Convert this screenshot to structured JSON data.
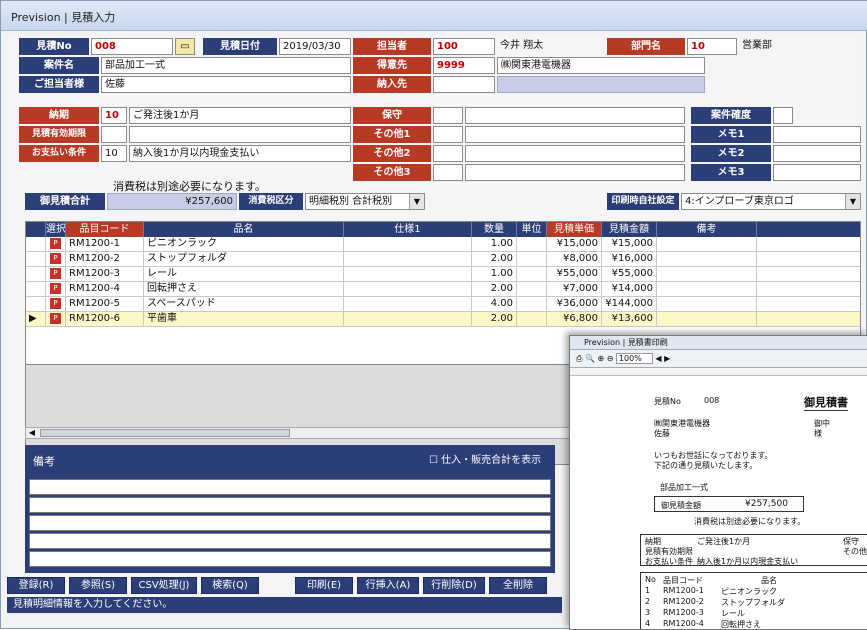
{
  "window": {
    "title": "Prevision | 見積入力"
  },
  "header": {
    "mitsumori_no_label": "見積No",
    "mitsumori_no": "008",
    "mitsumori_date_label": "見積日付",
    "mitsumori_date": "2019/03/30",
    "tanto_label": "担当者",
    "tanto_code": "100",
    "tanto_name": "今井 翔太",
    "bumon_label": "部門名",
    "bumon_code": "10",
    "bumon_name": "営業部",
    "kenmei_label": "案件名",
    "kenmei": "部品加工一式",
    "tokuisaki_label": "得意先",
    "tokuisaki_code": "9999",
    "tokuisaki_name": "㈱関東港電機器",
    "gotanto_label": "ご担当者様",
    "gotanto": "佐藤",
    "nounyu_label": "納入先",
    "nounyu": ""
  },
  "terms": {
    "nouki_label": "納期",
    "nouki_code": "10",
    "nouki": "ご発注後1か月",
    "yuko_label": "見積有効期限",
    "yuko": "",
    "shiharai_label": "お支払い条件",
    "shiharai_code": "10",
    "shiharai": "納入後1か月以内現金支払い",
    "hoshu_label": "保守",
    "hoshu": "",
    "other1_label": "その他1",
    "other1": "",
    "other2_label": "その他2",
    "other2": "",
    "other3_label": "その他3",
    "other3": "",
    "kakudo_label": "案件確度",
    "kakudo": "",
    "memo1_label": "メモ1",
    "memo1": "",
    "memo2_label": "メモ2",
    "memo2": "",
    "memo3_label": "メモ3",
    "memo3": ""
  },
  "summary": {
    "tax_note": "消費税は別途必要になります。",
    "total_label": "御見積合計",
    "total": "¥257,600",
    "tax_kubun_label": "消費税区分",
    "tax_kubun": "明細税別 合計税別",
    "print_label": "印刷時自社設定",
    "print_setting": "4:インプローブ東京ロゴ"
  },
  "grid": {
    "headers": [
      "選択",
      "品目コード",
      "品名",
      "仕様1",
      "数量",
      "単位",
      "見積単価",
      "見積金額",
      "備考"
    ],
    "rows": [
      {
        "code": "RM1200-1",
        "name": "ピニオンラック",
        "spec": "",
        "qty": "1.00",
        "unit": "",
        "price": "¥15,000",
        "amount": "¥15,000",
        "note": ""
      },
      {
        "code": "RM1200-2",
        "name": "ストップフォルダ",
        "spec": "",
        "qty": "2.00",
        "unit": "",
        "price": "¥8,000",
        "amount": "¥16,000",
        "note": ""
      },
      {
        "code": "RM1200-3",
        "name": "レール",
        "spec": "",
        "qty": "1.00",
        "unit": "",
        "price": "¥55,000",
        "amount": "¥55,000",
        "note": ""
      },
      {
        "code": "RM1200-4",
        "name": "回転押さえ",
        "spec": "",
        "qty": "2.00",
        "unit": "",
        "price": "¥7,000",
        "amount": "¥14,000",
        "note": ""
      },
      {
        "code": "RM1200-5",
        "name": "スペースパッド",
        "spec": "",
        "qty": "4.00",
        "unit": "",
        "price": "¥36,000",
        "amount": "¥144,000",
        "note": ""
      },
      {
        "code": "RM1200-6",
        "name": "平歯車",
        "spec": "",
        "qty": "2.00",
        "unit": "",
        "price": "¥6,800",
        "amount": "¥13,600",
        "note": ""
      }
    ]
  },
  "biko": {
    "label": "備考",
    "show_total_label": "仕入・販売合計を表示"
  },
  "buttons": {
    "register": "登録(R)",
    "reference": "参照(S)",
    "csv": "CSV処理(J)",
    "search": "検索(Q)",
    "print": "印刷(E)",
    "insert_row": "行挿入(A)",
    "delete_row": "行削除(D)",
    "delete_all": "全削除"
  },
  "status": "見積明細情報を入力してください。",
  "preview": {
    "title": "Prevision | 見積書印刷",
    "zoom": "100%",
    "doc_title": "御見積書",
    "no_label": "見積No",
    "no": "008",
    "customer": "㈱関東港電機器",
    "customer_suffix": "御中",
    "person": "佐藤",
    "person_suffix": "様",
    "greeting1": "いつもお世話になっております。",
    "greeting2": "下記の通り見積いたします。",
    "kenmei": "部品加工一式",
    "total_label": "御見積金額",
    "total": "¥257,500",
    "tax_note": "消費税は別途必要になります。",
    "nouki_label": "納期",
    "nouki": "ご発注後1か月",
    "yuko_label": "見積有効期限",
    "shiharai_label": "お支払い条件",
    "shiharai": "納入後1か月以内現金支払い",
    "hoshu_label": "保守",
    "other_label": "その他",
    "table_no": "No",
    "table_code": "品目コード",
    "table_name": "品名",
    "rows": [
      {
        "no": "1",
        "code": "RM1200-1",
        "name": "ピニオンラック"
      },
      {
        "no": "2",
        "code": "RM1200-2",
        "name": "ストップフォルダ"
      },
      {
        "no": "3",
        "code": "RM1200-3",
        "name": "レール"
      },
      {
        "no": "4",
        "code": "RM1200-4",
        "name": "回転押さえ"
      }
    ]
  }
}
